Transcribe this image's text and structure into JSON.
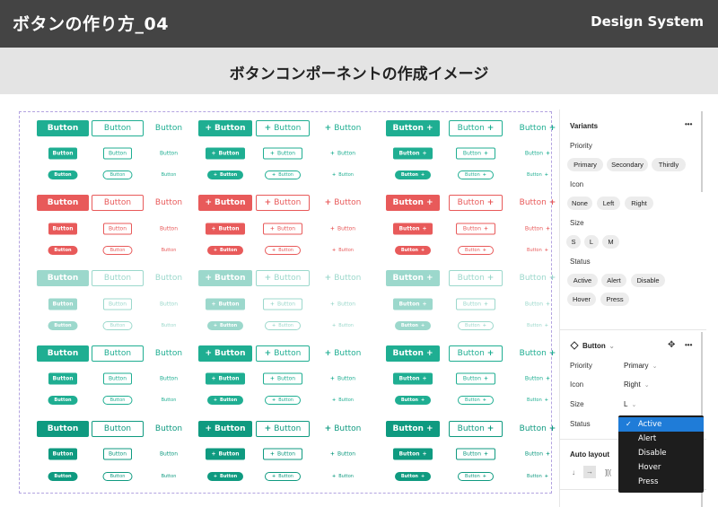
{
  "header": {
    "title": "ボタンの作り方_04",
    "brand": "Design System"
  },
  "subheader": {
    "title": "ボタンコンポーネントの作成イメージ"
  },
  "button_label": "Button",
  "colors": {
    "teal": "#1fae92",
    "red": "#e85a5a",
    "light": "#9cd8cc",
    "teal_dark": "#0f9a80",
    "grid_border": "#b3a3e0"
  },
  "panel": {
    "variants": {
      "title": "Variants",
      "more": "•••",
      "groups": [
        {
          "label": "Priority",
          "options": [
            "Primary",
            "Secondary",
            "Thirdly"
          ]
        },
        {
          "label": "Icon",
          "options": [
            "None",
            "Left",
            "Right"
          ]
        },
        {
          "label": "Size",
          "options": [
            "S",
            "L",
            "M"
          ]
        },
        {
          "label": "Status",
          "options": [
            "Active",
            "Alert",
            "Disable",
            "Hover",
            "Press"
          ]
        }
      ]
    },
    "instance": {
      "icon": "component-icon",
      "name": "Button",
      "chevron": "⌄",
      "move": "✥",
      "more": "•••",
      "props": [
        {
          "label": "Priority",
          "value": "Primary"
        },
        {
          "label": "Icon",
          "value": "Right"
        },
        {
          "label": "Size",
          "value": "L"
        },
        {
          "label": "Status",
          "value": ""
        }
      ]
    },
    "auto_layout": {
      "title": "Auto layout",
      "icons": [
        "↓",
        "→",
        "][("
      ]
    }
  },
  "dropdown": {
    "options": [
      "Active",
      "Alert",
      "Disable",
      "Hover",
      "Press"
    ],
    "selected": "Active",
    "check": "✓"
  }
}
